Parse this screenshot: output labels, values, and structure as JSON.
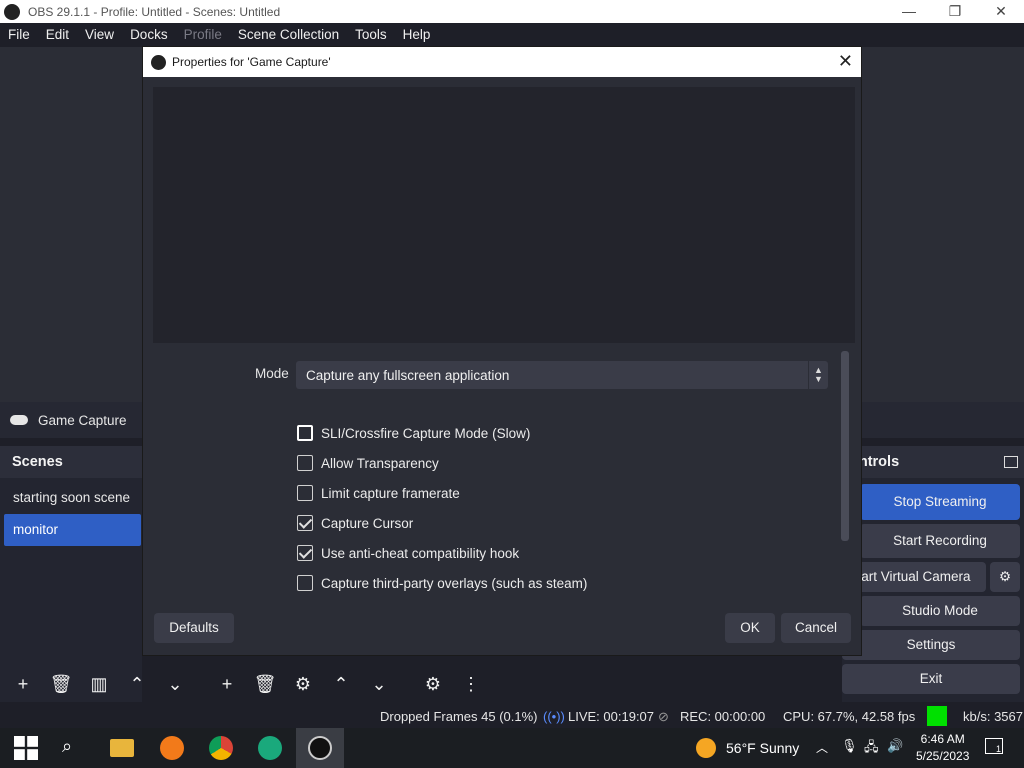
{
  "window": {
    "title": "OBS 29.1.1 - Profile: Untitled - Scenes: Untitled",
    "minimize": "—",
    "maximize": "❐",
    "close": "✕"
  },
  "menu": {
    "items": [
      "File",
      "Edit",
      "View",
      "Docks",
      "Profile",
      "Scene Collection",
      "Tools",
      "Help"
    ],
    "disabled_index": 4
  },
  "source_bar": {
    "label": "Game Capture",
    "icon": "gamepad-icon"
  },
  "scenes_dock": {
    "title": "Scenes",
    "items": [
      "starting soon scene",
      "monitor"
    ],
    "active_index": 1
  },
  "controls_dock": {
    "title": "ontrols",
    "buttons": [
      "Stop Streaming",
      "Start Recording",
      "tart Virtual Camera",
      "Studio Mode",
      "Settings",
      "Exit"
    ]
  },
  "dialog": {
    "title": "Properties for 'Game Capture'",
    "mode_label": "Mode",
    "mode_value": "Capture any fullscreen application",
    "checkboxes": [
      {
        "label": "SLI/Crossfire Capture Mode (Slow)",
        "checked": false
      },
      {
        "label": "Allow Transparency",
        "checked": false
      },
      {
        "label": "Limit capture framerate",
        "checked": false
      },
      {
        "label": "Capture Cursor",
        "checked": true
      },
      {
        "label": "Use anti-cheat compatibility hook",
        "checked": true
      },
      {
        "label": "Capture third-party overlays (such as steam)",
        "checked": false
      }
    ],
    "defaults_label": "Defaults",
    "ok_label": "OK",
    "cancel_label": "Cancel"
  },
  "status": {
    "dropped_frames": "Dropped Frames 45 (0.1%)",
    "live": "LIVE: 00:19:07",
    "rec": "REC: 00:00:00",
    "cpu": "CPU: 67.7%, 42.58 fps",
    "kbps": "kb/s: 3567",
    "indicator_color": "#00e000"
  },
  "taskbar": {
    "weather": "56°F  Sunny",
    "time": "6:46 AM",
    "date": "5/25/2023",
    "notifications": "1"
  }
}
